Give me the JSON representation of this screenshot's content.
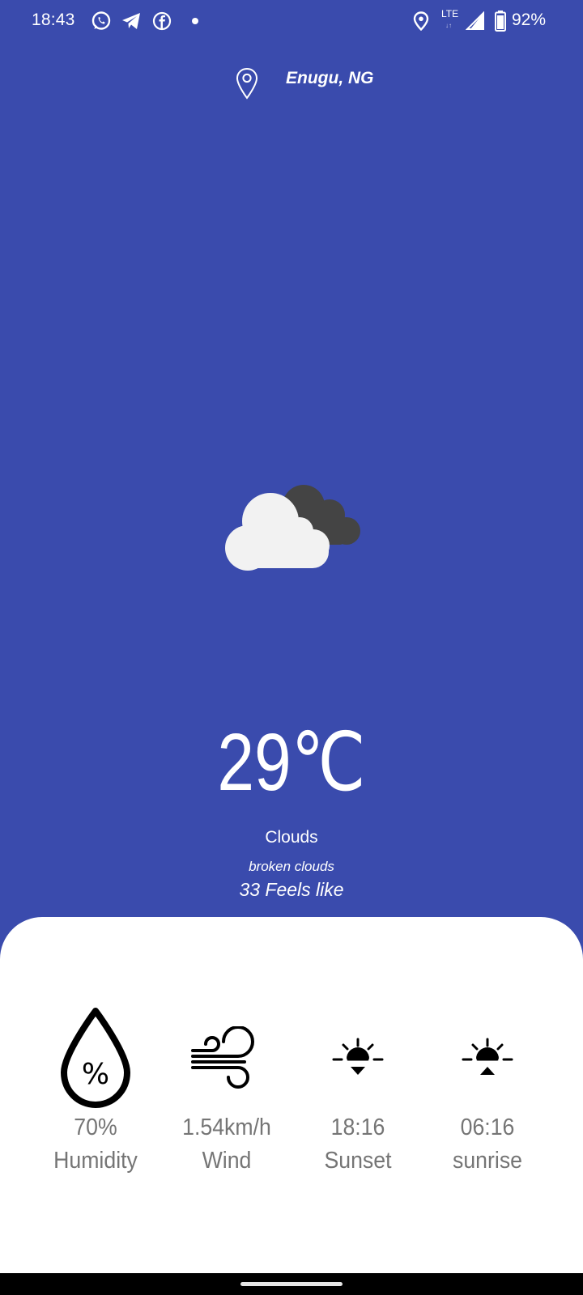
{
  "status_bar": {
    "time": "18:43",
    "network_label": "LTE",
    "network_arrows": "↓↑",
    "battery_percent": "92%",
    "battery_level": 0.92,
    "left_icons": [
      "whatsapp-icon",
      "telegram-icon",
      "facebook-icon",
      "notification-dot-icon"
    ],
    "right_icons": [
      "location-icon",
      "lte-icon",
      "signal-icon",
      "battery-icon"
    ]
  },
  "header": {
    "location": "Enugu,  NG",
    "pin_icon": "location-pin-icon"
  },
  "weather": {
    "icon": "broken-clouds-icon",
    "temperature": "29℃",
    "main": "Clouds",
    "description": "broken clouds",
    "feels_like": "33 Feels like"
  },
  "stats": [
    {
      "icon": "humidity-drop-icon",
      "value": "70%",
      "label": "Humidity"
    },
    {
      "icon": "wind-icon",
      "value": "1.54km/h",
      "label": "Wind"
    },
    {
      "icon": "sunset-icon",
      "value": "18:16",
      "label": "Sunset"
    },
    {
      "icon": "sunrise-icon",
      "value": "06:16",
      "label": "sunrise"
    }
  ],
  "colors": {
    "background": "#3a4bad",
    "card": "#ffffff",
    "stat_text": "#757575",
    "cloud_front": "#f2f2f2",
    "cloud_back": "#444444"
  }
}
